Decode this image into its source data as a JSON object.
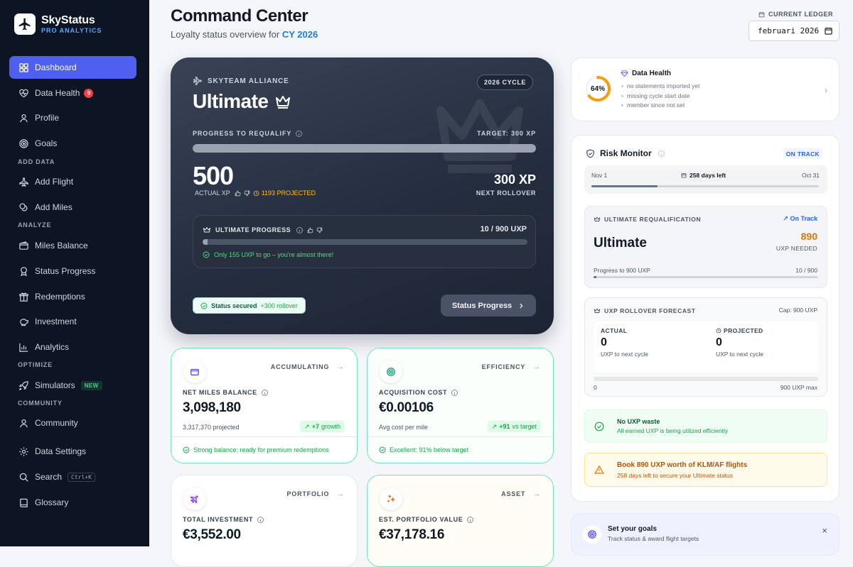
{
  "app": {
    "name": "SkyStatus",
    "subtitle": "PRO ANALYTICS"
  },
  "sidebar": {
    "items": [
      {
        "label": "Dashboard",
        "icon": "grid-icon"
      },
      {
        "label": "Data Health",
        "icon": "heart-pulse-icon",
        "badge": "9"
      },
      {
        "label": "Profile",
        "icon": "user-icon"
      },
      {
        "label": "Goals",
        "icon": "target-icon"
      },
      {
        "label": "Add Flight",
        "icon": "plane-icon"
      },
      {
        "label": "Add Miles",
        "icon": "coins-icon"
      },
      {
        "label": "Miles Balance",
        "icon": "wallet-icon"
      },
      {
        "label": "Status Progress",
        "icon": "award-icon"
      },
      {
        "label": "Redemptions",
        "icon": "gift-icon"
      },
      {
        "label": "Investment",
        "icon": "piggy-bank-icon"
      },
      {
        "label": "Analytics",
        "icon": "bar-chart-icon"
      },
      {
        "label": "Simulators",
        "icon": "rocket-icon",
        "badge": "NEW"
      },
      {
        "label": "Community",
        "icon": "users-icon"
      },
      {
        "label": "Data Settings",
        "icon": "gear-icon"
      },
      {
        "label": "Search",
        "icon": "search-icon",
        "shortcut": "Ctrl+K"
      },
      {
        "label": "Glossary",
        "icon": "book-icon"
      }
    ],
    "sections": [
      "ADD DATA",
      "ANALYZE",
      "OPTIMIZE",
      "COMMUNITY"
    ]
  },
  "header": {
    "title": "Command Center",
    "subtitle_prefix": "Loyalty status overview for",
    "subtitle_year": "CY 2026",
    "ledger_label": "CURRENT LEDGER",
    "ledger_value": "februari 2026"
  },
  "hero": {
    "alliance": "SKYTEAM ALLIANCE",
    "cycle": "2026 CYCLE",
    "tier": "Ultimate",
    "progress_label": "PROGRESS TO REQUALIFY",
    "target": "TARGET: 300 XP",
    "progress_fraction": 1.0,
    "actual_xp": "500",
    "actual_xp_label": "ACTUAL XP",
    "projected": "1193 PROJECTED",
    "rollover_value": "300 XP",
    "rollover_label": "NEXT ROLLOVER",
    "uxp_title": "ULTIMATE PROGRESS",
    "uxp_value": "10 / 900 UXP",
    "uxp_fraction": 0.011,
    "uxp_message": "Only 155 UXP to go – you're almost there!",
    "secured_label": "Status secured",
    "secured_extra": "+300 rollover",
    "button": "Status Progress"
  },
  "cards": [
    {
      "tag": "ACCUMULATING",
      "label": "NET MILES BALANCE",
      "value": "3,098,180",
      "sub": "3,317,370 projected",
      "pill_value": "+7",
      "pill_text": "growth",
      "footer": "Strong balance: ready for premium redemptions",
      "icon": "wallet-icon",
      "accent": "#4f46e5"
    },
    {
      "tag": "EFFICIENCY",
      "label": "ACQUISITION COST",
      "value": "€0.00106",
      "sub": "Avg cost per mile",
      "pill_value": "+91",
      "pill_text": "vs target",
      "footer": "Excellent: 91% below target",
      "icon": "target-icon",
      "accent": "#059669"
    },
    {
      "tag": "PORTFOLIO",
      "label": "TOTAL INVESTMENT",
      "value": "€3,552.00",
      "icon": "plane-icon",
      "accent": "#7c3aed"
    },
    {
      "tag": "ASSET",
      "label": "EST. PORTFOLIO VALUE",
      "value": "€37,178.16",
      "icon": "sparkle-icon",
      "accent": "#ea580c"
    }
  ],
  "data_health": {
    "percent": "64%",
    "percent_value": 0.64,
    "title": "Data Health",
    "items": [
      "no statements imported yet",
      "missing cycle start date",
      "member since not set"
    ]
  },
  "risk": {
    "title": "Risk Monitor",
    "status": "ON TRACK",
    "start": "Nov 1",
    "days_left": "258 days left",
    "end": "Oct 31",
    "elapsed_fraction": 0.29,
    "requal": {
      "title": "ULTIMATE REQUALIFICATION",
      "status": "On Track",
      "tier": "Ultimate",
      "needed": "890",
      "needed_label": "UXP NEEDED",
      "progress_label": "Progress to 900 UXP",
      "progress_value": "10 / 900",
      "progress_fraction": 0.011
    },
    "forecast": {
      "title": "UXP ROLLOVER FORECAST",
      "cap": "Cap: 900 UXP",
      "actual_label": "ACTUAL",
      "actual_value": "0",
      "actual_sub": "UXP to next cycle",
      "projected_label": "PROJECTED",
      "projected_value": "0",
      "projected_sub": "UXP to next cycle",
      "min": "0",
      "max": "900 UXP max"
    },
    "waste": {
      "title": "No UXP waste",
      "sub": "All earned UXP is being utilized efficiently"
    },
    "alert": {
      "title": "Book 890 UXP worth of KLM/AF flights",
      "sub": "258 days left to secure your Ultimate status"
    }
  },
  "goals": {
    "title": "Set your goals",
    "sub": "Track status & award flight targets",
    "close": "×"
  },
  "colors": {
    "sidebar_bg": "#0d1424",
    "active_nav": "#4f5ff0",
    "accent_blue": "#1d7ed6",
    "success": "#16a34a",
    "warning": "#d97706"
  }
}
